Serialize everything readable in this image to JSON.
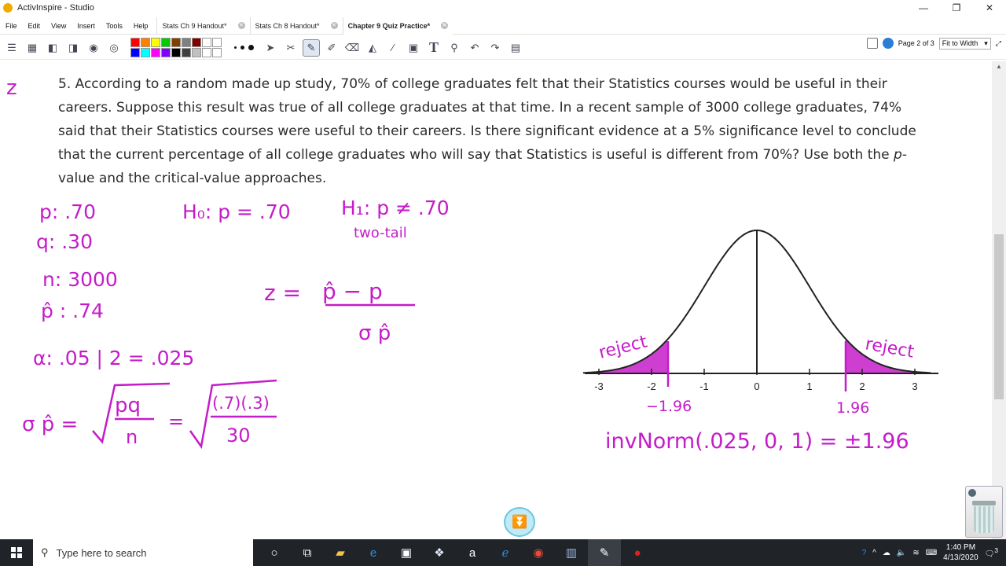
{
  "window": {
    "title": "ActivInspire - Studio",
    "minimize": "—",
    "restore": "❐",
    "close": "✕"
  },
  "menu": [
    "File",
    "Edit",
    "View",
    "Insert",
    "Tools",
    "Help"
  ],
  "tabs": [
    {
      "label": "Stats Ch 9 Handout*",
      "active": false
    },
    {
      "label": "Stats Ch 8 Handout*",
      "active": false
    },
    {
      "label": "Chapter 9 Quiz Practice*",
      "active": true
    }
  ],
  "page_nav": {
    "page_label": "Page 2 of 3",
    "zoom": "Fit to Width"
  },
  "palette_colors": [
    "#ff0000",
    "#ff8000",
    "#ffff00",
    "#00cc00",
    "#804000",
    "#808080",
    "#800000",
    "#ffffff",
    "#ffffff",
    "#0000ff",
    "#00ffff",
    "#ff00ff",
    "#8000ff",
    "#000000",
    "#404040",
    "#c0c0c0",
    "#ffffff",
    "#ffffff"
  ],
  "problem": {
    "text_before": "5. According to a random made up study, 70% of college graduates felt that their Statistics courses would be useful in their careers. Suppose this result was true of all college graduates at that time. In a recent sample of 3000 college graduates, 74% said that their Statistics courses were useful to their careers. Is there significant evidence at a 5% significance level to conclude that the current percentage of all college graduates who will say that Statistics is useful is different from 70%? Use both the ",
    "italic": "p",
    "text_after": "-value and the critical-value approaches."
  },
  "handwriting": {
    "z_margin": "z",
    "p": "p: .70",
    "q": "q: .30",
    "n": "n: 3000",
    "phat": "p̂ : .74",
    "alpha": "α: .05 | 2 = .025",
    "h0": "H₀: p = .70",
    "h1": "H₁: p ≠ .70",
    "two_tail": "two-tail",
    "z_formula_left": "z =",
    "z_numerator": "p̂ − p",
    "z_denominator": "σ p̂",
    "sigma_left": "σ p̂ =",
    "pq": "pq",
    "n_under": "n",
    "equals": "=",
    "num_calc": "(.7)(.3)",
    "den_calc": "30",
    "reject_left": "reject",
    "reject_right": "reject",
    "crit_left": "−1.96",
    "crit_right": "1.96",
    "invnorm": "invNorm(.025, 0, 1) = ±1.96"
  },
  "curve_ticks": [
    "-3",
    "-2",
    "-1",
    "0",
    "1",
    "2",
    "3"
  ],
  "taskbar": {
    "search_placeholder": "Type here to search",
    "time": "1:40 PM",
    "date": "4/13/2020",
    "notification_count": "3"
  }
}
